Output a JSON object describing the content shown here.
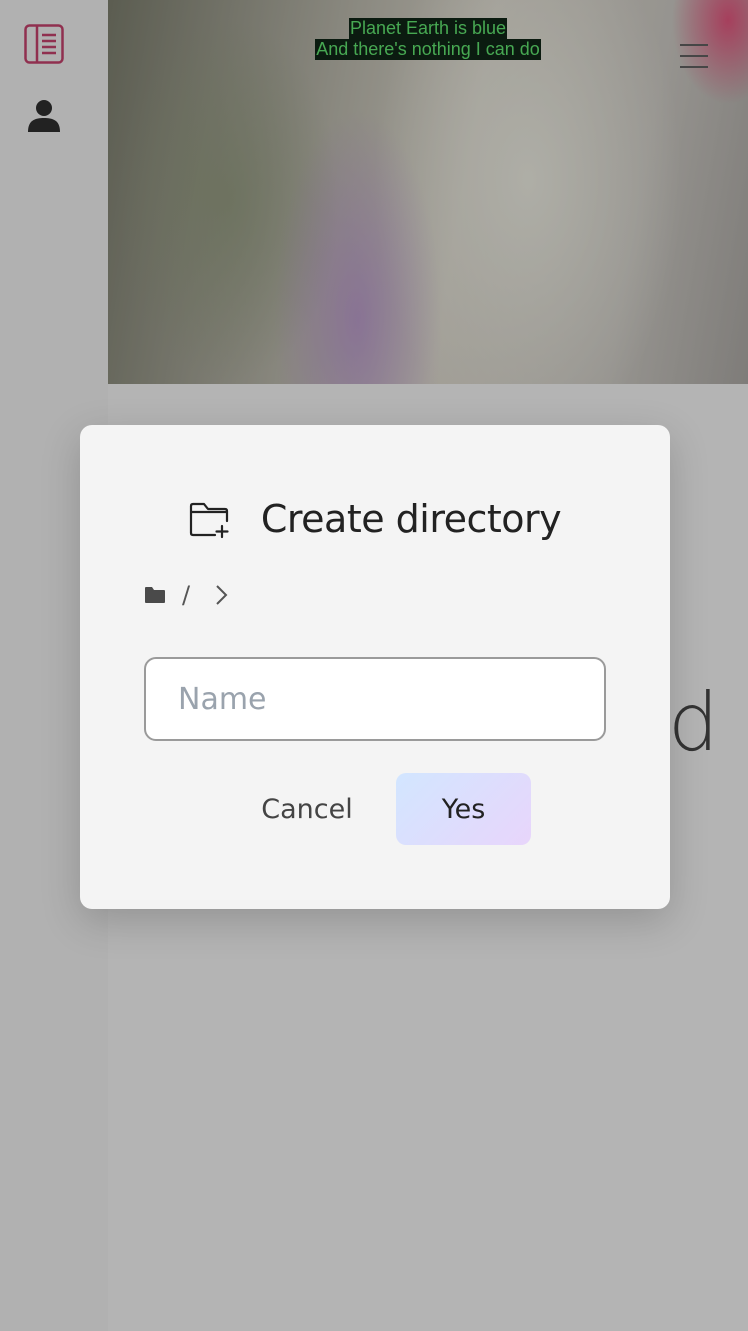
{
  "sidebar": {
    "menu_icon": "book-list-icon",
    "user_icon": "user-icon",
    "accent_color": "#c0406a"
  },
  "banner": {
    "lyrics_line1": "Planet Earth is blue",
    "lyrics_line2": "And there's nothing I can do",
    "menu_icon": "hamburger-icon"
  },
  "background": {
    "partial_big_text": "d"
  },
  "dialog": {
    "title": "Create directory",
    "title_icon": "folder-plus-icon",
    "breadcrumb": {
      "root_icon": "folder-icon",
      "separator": "/",
      "chevron_icon": "chevron-right-icon"
    },
    "name_input": {
      "value": "",
      "placeholder": "Name"
    },
    "cancel_label": "Cancel",
    "yes_label": "Yes"
  }
}
